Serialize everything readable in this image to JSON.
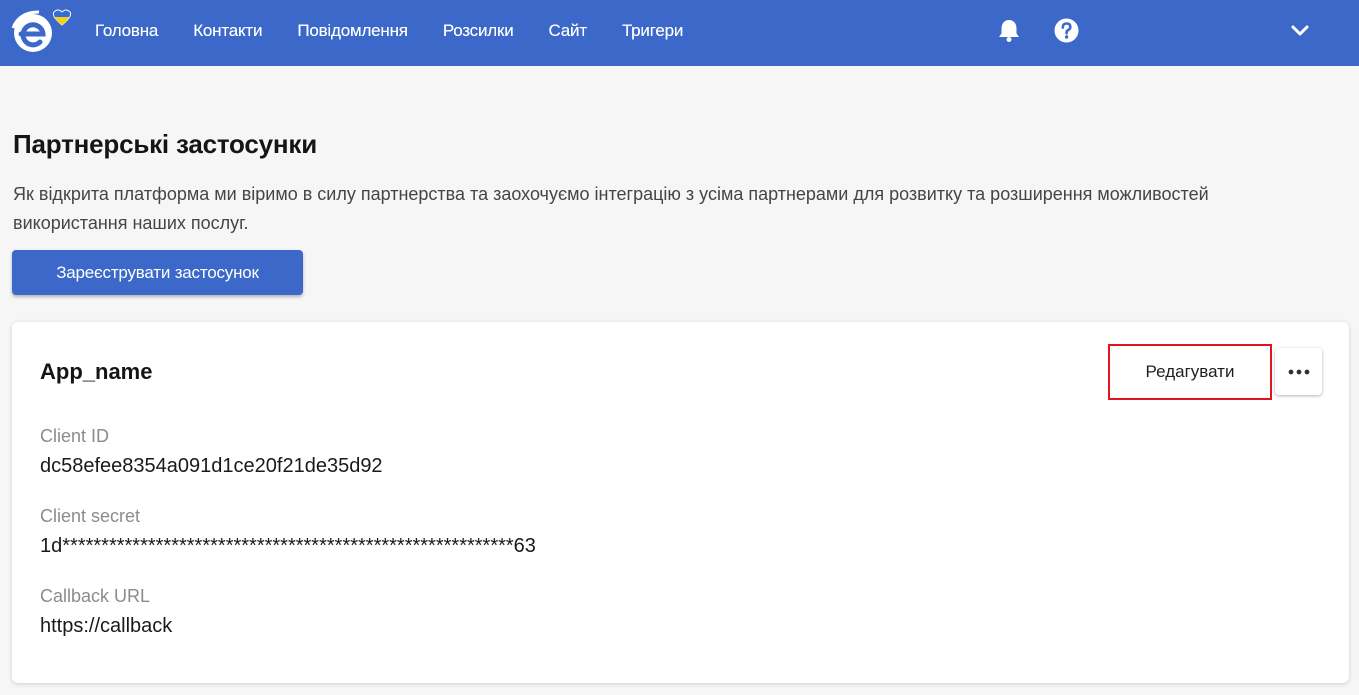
{
  "nav": {
    "items": [
      {
        "label": "Головна"
      },
      {
        "label": "Контакти"
      },
      {
        "label": "Повідомлення"
      },
      {
        "label": "Розсилки"
      },
      {
        "label": "Сайт"
      },
      {
        "label": "Тригери"
      }
    ],
    "icons": [
      "bell-icon",
      "help-icon",
      "chevron-down-icon"
    ]
  },
  "colors": {
    "header": "#3b68c9",
    "button": "#3b68c9",
    "highlight": "#e0161c"
  },
  "page": {
    "title": "Партнерські застосунки",
    "description": "Як відкрита платформа ми віримо в силу партнерства та заохочуємо інтеграцію з усіма партнерами для розвитку та розширення можливостей використання наших послуг.",
    "register_button": "Зареєструвати застосунок"
  },
  "app": {
    "name": "App_name",
    "edit_button": "Редагувати",
    "fields": [
      {
        "label": "Client ID",
        "value": "dc58efee8354a091d1ce20f21de35d92"
      },
      {
        "label": "Client secret",
        "value": "1d**********************************************************63"
      },
      {
        "label": "Callback URL",
        "value": "https://callback"
      }
    ]
  }
}
